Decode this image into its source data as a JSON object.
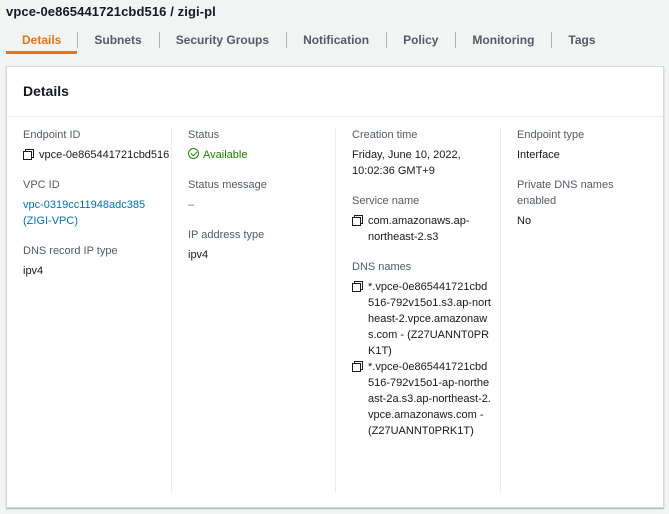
{
  "page": {
    "title": "vpce-0e865441721cbd516 / zigi-pl"
  },
  "tabs": [
    {
      "label": "Details",
      "active": true
    },
    {
      "label": "Subnets"
    },
    {
      "label": "Security Groups"
    },
    {
      "label": "Notification"
    },
    {
      "label": "Policy"
    },
    {
      "label": "Monitoring"
    },
    {
      "label": "Tags"
    }
  ],
  "panel": {
    "title": "Details"
  },
  "fields": {
    "endpoint_id": {
      "label": "Endpoint ID",
      "value": "vpce-0e865441721cbd516"
    },
    "vpc_id": {
      "label": "VPC ID",
      "value": "vpc-0319cc11948adc385 (ZIGI-VPC)"
    },
    "dns_record_ip_type": {
      "label": "DNS record IP type",
      "value": "ipv4"
    },
    "status": {
      "label": "Status",
      "value": "Available",
      "color": "#1d8102"
    },
    "status_message": {
      "label": "Status message",
      "value": "–"
    },
    "ip_address_type": {
      "label": "IP address type",
      "value": "ipv4"
    },
    "creation_time": {
      "label": "Creation time",
      "value": "Friday, June 10, 2022, 10:02:36 GMT+9"
    },
    "service_name": {
      "label": "Service name",
      "value": "com.amazonaws.ap-northeast-2.s3"
    },
    "dns_names": {
      "label": "DNS names",
      "values": [
        "*.vpce-0e865441721cbd516-792v15o1.s3.ap-northeast-2.vpce.amazonaws.com - (Z27UANNT0PRK1T)",
        "*.vpce-0e865441721cbd516-792v15o1-ap-northeast-2a.s3.ap-northeast-2.vpce.amazonaws.com - (Z27UANNT0PRK1T)"
      ]
    },
    "endpoint_type": {
      "label": "Endpoint type",
      "value": "Interface"
    },
    "private_dns": {
      "label": "Private DNS names enabled",
      "value": "No"
    }
  },
  "colors": {
    "accent": "#ec7211",
    "link": "#0073bb",
    "success": "#1d8102"
  },
  "icons": {
    "copy": "copy-icon",
    "status": "check-circle-icon"
  }
}
